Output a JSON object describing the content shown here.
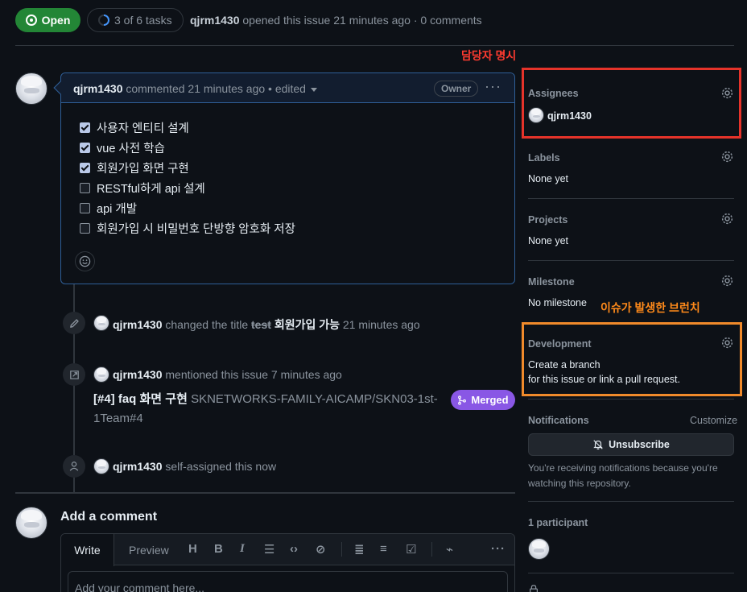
{
  "issue": {
    "state_label": "Open",
    "tasks_label": "3 of 6 tasks",
    "author": "qjrm1430",
    "opened_text": "opened this issue 21 minutes ago · 0 comments"
  },
  "comment": {
    "author": "qjrm1430",
    "meta": "commented 21 minutes ago • edited",
    "role_badge": "Owner",
    "tasks": [
      {
        "label": "사용자 엔티티 설계",
        "checked": true
      },
      {
        "label": "vue 사전 학습",
        "checked": true
      },
      {
        "label": "회원가입 화면 구현",
        "checked": true
      },
      {
        "label": "RESTful하게 api 설계",
        "checked": false
      },
      {
        "label": "api 개발",
        "checked": false
      },
      {
        "label": "회원가입 시 비밀번호 단방향 암호화 저장",
        "checked": false
      }
    ]
  },
  "timeline": {
    "rename": {
      "author": "qjrm1430",
      "action": "changed the title",
      "old_title": "test",
      "new_title": "회원가입 가능",
      "time": "21 minutes ago"
    },
    "mention": {
      "author": "qjrm1430",
      "action": "mentioned this issue 7 minutes ago",
      "pr_title": "[#4] faq 화면 구현",
      "pr_ref": "SKNETWORKS-FAMILY-AICAMP/SKN03-1st-1Team#4",
      "pr_status": "Merged"
    },
    "assign": {
      "author": "qjrm1430",
      "action": "self-assigned this now"
    }
  },
  "add_comment": {
    "title": "Add a comment",
    "tab_write": "Write",
    "tab_preview": "Preview",
    "placeholder": "Add your comment here..."
  },
  "sidebar": {
    "assignees": {
      "label": "Assignees",
      "value": "qjrm1430"
    },
    "labels": {
      "label": "Labels",
      "value": "None yet"
    },
    "projects": {
      "label": "Projects",
      "value": "None yet"
    },
    "milestone": {
      "label": "Milestone",
      "value": "No milestone"
    },
    "development": {
      "label": "Development",
      "link": "Create a branch",
      "suffix": "for this issue or link a pull request."
    },
    "notifications": {
      "label": "Notifications",
      "customize": "Customize",
      "button": "Unsubscribe",
      "description": "You're receiving notifications because you're watching this repository."
    },
    "participants": {
      "label": "1 participant"
    }
  },
  "annotations": {
    "assignee_note": "담당자 명시",
    "branch_note": "이슈가 발생한 브런치"
  },
  "colors": {
    "open_green": "#238636",
    "merged_purple": "#8957e5",
    "link_blue": "#4493f8",
    "annotation_red": "#e5332a",
    "annotation_orange": "#f08a2b"
  }
}
